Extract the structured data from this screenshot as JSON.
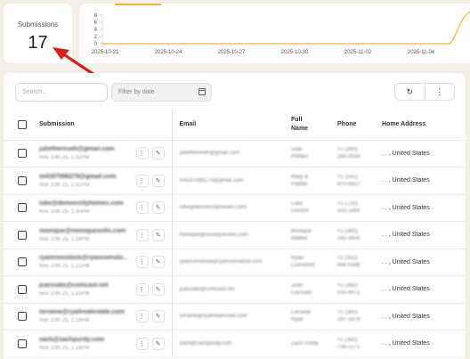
{
  "stat": {
    "label": "Submissions",
    "value": "17"
  },
  "chart_data": {
    "type": "line",
    "x": [
      "2025-10-21",
      "2025-10-24",
      "2025-10-27",
      "2025-10-30",
      "2025-11-02",
      "2025-11-04",
      "2025-11-05"
    ],
    "yticks": [
      "8",
      "6",
      "4",
      "2",
      "0"
    ],
    "series": [
      {
        "values": [
          0,
          0,
          0,
          0,
          0,
          0,
          8
        ]
      }
    ],
    "ylim": [
      0,
      8
    ],
    "color": "#f2b23a"
  },
  "toolbar": {
    "search_placeholder": "Search...",
    "date_placeholder": "Filter by date",
    "refresh_icon": "↻",
    "more_icon": "⋮"
  },
  "table": {
    "headers": {
      "submission": "Submission",
      "email": "Email",
      "full_name_1": "Full",
      "full_name_2": "Name",
      "phone": "Phone",
      "address": "Home Address"
    },
    "rows": [
      {
        "sub": "juliethereseh@gmail.com",
        "date": "Nov 10th 25, 1:32PM",
        "email": "juliethereseh@gmail.com",
        "first": "Julie",
        "last": "Phillips",
        "p1": "+1 (360)",
        "p2": "283-3533",
        "addr": ". . , United States"
      },
      {
        "sub": "m4187086279@gmail.com",
        "date": "Nov 10th 25, 1:31PM",
        "email": "m4187086279@gmail.com",
        "first": "Mary B",
        "last": "Padilla",
        "p1": "+1 (541)",
        "p2": "870-8927",
        "addr": ". . , United States"
      },
      {
        "sub": "luke@denvercityhomes.com",
        "date": "Nov 10th 25, 1:30PM",
        "email": "luke@denvercityhomes.com",
        "first": "Luke",
        "last": "Gordon",
        "p1": "+1 (720)",
        "p2": "333-1494",
        "addr": ". . , United States"
      },
      {
        "sub": "monique@moniquesells.com",
        "date": "Nov 10th 25, 1:28PM",
        "email": "monique@moniquesells.com",
        "first": "Monique",
        "last": "Walker",
        "p1": "+1 (360)",
        "p2": "241-3816",
        "addr": ". . , United States"
      },
      {
        "sub": "ryancomstock@ryancomsto...",
        "date": "Nov 10th 25, 1:21PM",
        "email": "ryancomstock@ryancomstock.com",
        "first": "Ryan",
        "last": "Comstock",
        "p1": "+1 (352)",
        "p2": "048-8388",
        "addr": ". . , United States"
      },
      {
        "sub": "jcacciato@comcast.net",
        "date": "Nov 10th 25, 1:20PM",
        "email": "jcacciato@comcast.net",
        "first": "John",
        "last": "Cacciato",
        "p1": "+1 (360)",
        "p2": "035-8471",
        "addr": ". . , United States"
      },
      {
        "sub": "lorraine@ryallrealestate.com",
        "date": "Nov 10th 25, 1:19PM",
        "email": "lorraine@ryallrealestate.com",
        "first": "Lorraine",
        "last": "Ryall",
        "p1": "+1 (360)",
        "p2": "297-1679",
        "addr": ". . , United States"
      },
      {
        "sub": "zach@zachpurdy.com",
        "date": "Nov 10th 25, 1:18PM",
        "email": "zach@zachpurdy.com",
        "first": "Zach Purdy",
        "last": "",
        "p1": "+1 (360)",
        "p2": "736-1271",
        "addr": ". . , United States"
      }
    ],
    "row_menu_icon": "⋮",
    "row_edit_icon": "✎"
  }
}
